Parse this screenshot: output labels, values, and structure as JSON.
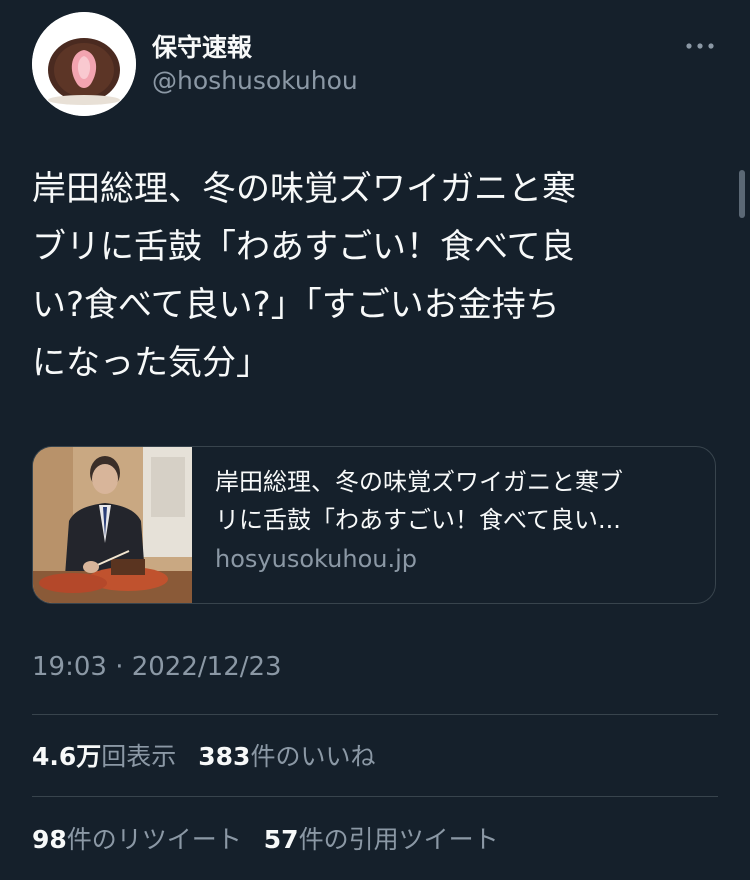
{
  "author": {
    "display_name": "保守速報",
    "handle": "@hoshusokuhou"
  },
  "icons": {
    "more": "more-horizontal-icon",
    "avatar": "strawberry-daifuku-avatar"
  },
  "tweet": {
    "text_lines": [
      "岸田総理、冬の味覚ズワイガニと寒",
      "ブリに舌鼓「わあすごい！食べて良",
      "い?食べて良い?」「すごいお金持ち",
      "になった気分」"
    ],
    "timestamp": "19:03 · 2022/12/23"
  },
  "link_card": {
    "title_line1": "岸田総理、冬の味覚ズワイガニと寒ブ",
    "title_line2": "リに舌鼓「わあすごい！食べて良い...",
    "domain": "hosyusokuhou.jp"
  },
  "stats_row1": {
    "views_count": "4.6万",
    "views_label": "回表示",
    "likes_count": "383",
    "likes_label": "件のいいね"
  },
  "stats_row2": {
    "retweets_count": "98",
    "retweets_label": "件のリツイート",
    "quotes_count": "57",
    "quotes_label": "件の引用ツイート"
  },
  "colors": {
    "background": "#15202b",
    "primary_text": "#f7f9f9",
    "secondary_text": "#8b98a5",
    "border": "#38444d"
  }
}
